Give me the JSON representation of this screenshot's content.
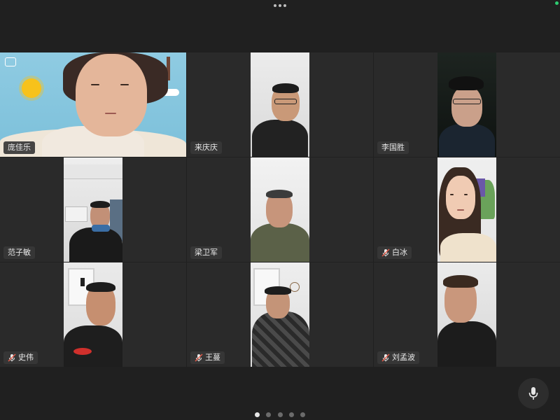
{
  "top_bar": {
    "more_icon": "more-horizontal-icon",
    "status_icon": "connected-dot-icon",
    "status_color": "#2ecc71"
  },
  "participants": [
    {
      "name": "庞佳乐",
      "muted": false,
      "camera_switch": true
    },
    {
      "name": "来庆庆",
      "muted": false
    },
    {
      "name": "李国胜",
      "muted": false
    },
    {
      "name": "范子敏",
      "muted": false
    },
    {
      "name": "梁卫军",
      "muted": false
    },
    {
      "name": "白冰",
      "muted": true
    },
    {
      "name": "史伟",
      "muted": true
    },
    {
      "name": "王蔓",
      "muted": true
    },
    {
      "name": "刘孟波",
      "muted": true
    }
  ],
  "pagination": {
    "pages": 5,
    "current": 1
  },
  "controls": {
    "mic_icon": "microphone-icon"
  }
}
